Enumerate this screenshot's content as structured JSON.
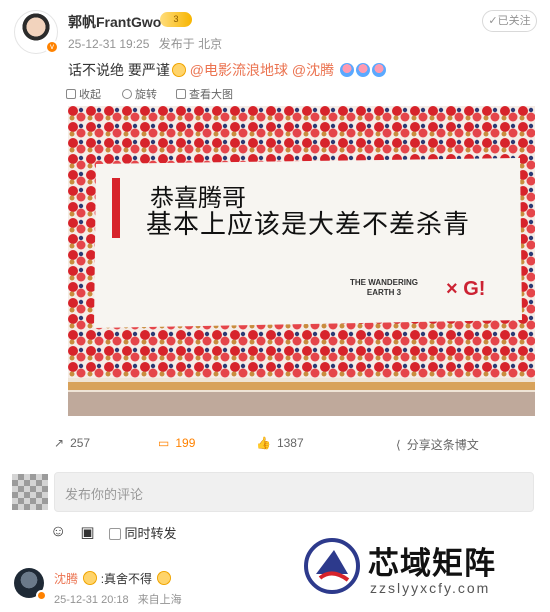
{
  "post": {
    "author": "郭帆FrantGwo",
    "vip_label": "3",
    "time": "25-12-31 19:25",
    "source": "发布于 北京",
    "follow_status": "已关注",
    "text_plain": "话不说绝 要严谨",
    "mention_film": "@电影流浪地球",
    "mention_shen": "@沈腾"
  },
  "image_toolbar": {
    "collect": "收起",
    "rotate": "旋转",
    "view_large": "查看大图"
  },
  "cake": {
    "line1": "恭喜腾哥",
    "line2": "基本上应该是大差不差杀青",
    "logo_text": "THE WANDERING EARTH 3",
    "brand": "× G!"
  },
  "stats": {
    "reposts": "257",
    "comments": "199",
    "likes": "1387",
    "share": "分享这条博文"
  },
  "comment": {
    "placeholder": "发布你的评论",
    "forward_label": "同时转发"
  },
  "reply": {
    "name": "沈腾",
    "text": ":真舍不得",
    "time": "25-12-31 20:18",
    "location": "来自上海"
  },
  "watermark": {
    "title": "芯域矩阵",
    "url": "zzslyyxcfy.com"
  },
  "colors": {
    "accent": "#ff8200",
    "link": "#eb7350"
  }
}
